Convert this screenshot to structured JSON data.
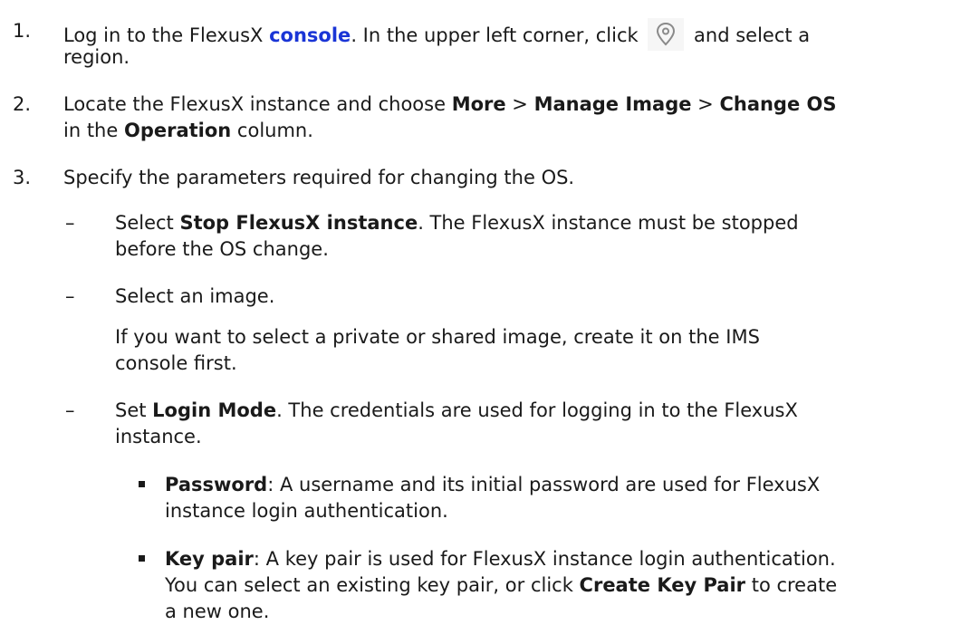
{
  "steps": [
    {
      "num": "1.",
      "pre": "Log in to the FlexusX ",
      "link": "console",
      "post": ". In the upper left corner, click ",
      "post2": " and select a",
      "cont": "region."
    },
    {
      "num": "2.",
      "pre": "Locate the FlexusX instance and choose ",
      "b1": "More",
      "s1": " > ",
      "b2": "Manage Image",
      "s2": " > ",
      "b3": "Change OS",
      "cont_pre": "in the ",
      "cont_b": "Operation",
      "cont_post": " column."
    },
    {
      "num": "3.",
      "text": "Specify the parameters required for changing the OS."
    }
  ],
  "subs": [
    {
      "dash": "–",
      "pre": "Select ",
      "b": "Stop FlexusX instance",
      "post": ". The FlexusX instance must be stopped",
      "cont": "before the OS change."
    },
    {
      "dash": "–",
      "text": "Select an image.",
      "p1": "If you want to select a private or shared image, create it on the IMS",
      "p2": "console first."
    },
    {
      "dash": "–",
      "pre": "Set ",
      "b": "Login Mode",
      "post": ". The credentials are used for logging in to the FlexusX",
      "cont": "instance."
    }
  ],
  "bullets": [
    {
      "b": "Password",
      "l1": ": A username and its initial password are used for FlexusX",
      "l2": "instance login authentication."
    },
    {
      "b": "Key pair",
      "l1": ": A key pair is used for FlexusX instance login authentication.",
      "l2_pre": "You can select an existing key pair, or click ",
      "l2_b": "Create Key Pair",
      "l2_post": " to create",
      "l3": "a new one."
    }
  ],
  "icons": {
    "region": "location-pin-icon"
  }
}
